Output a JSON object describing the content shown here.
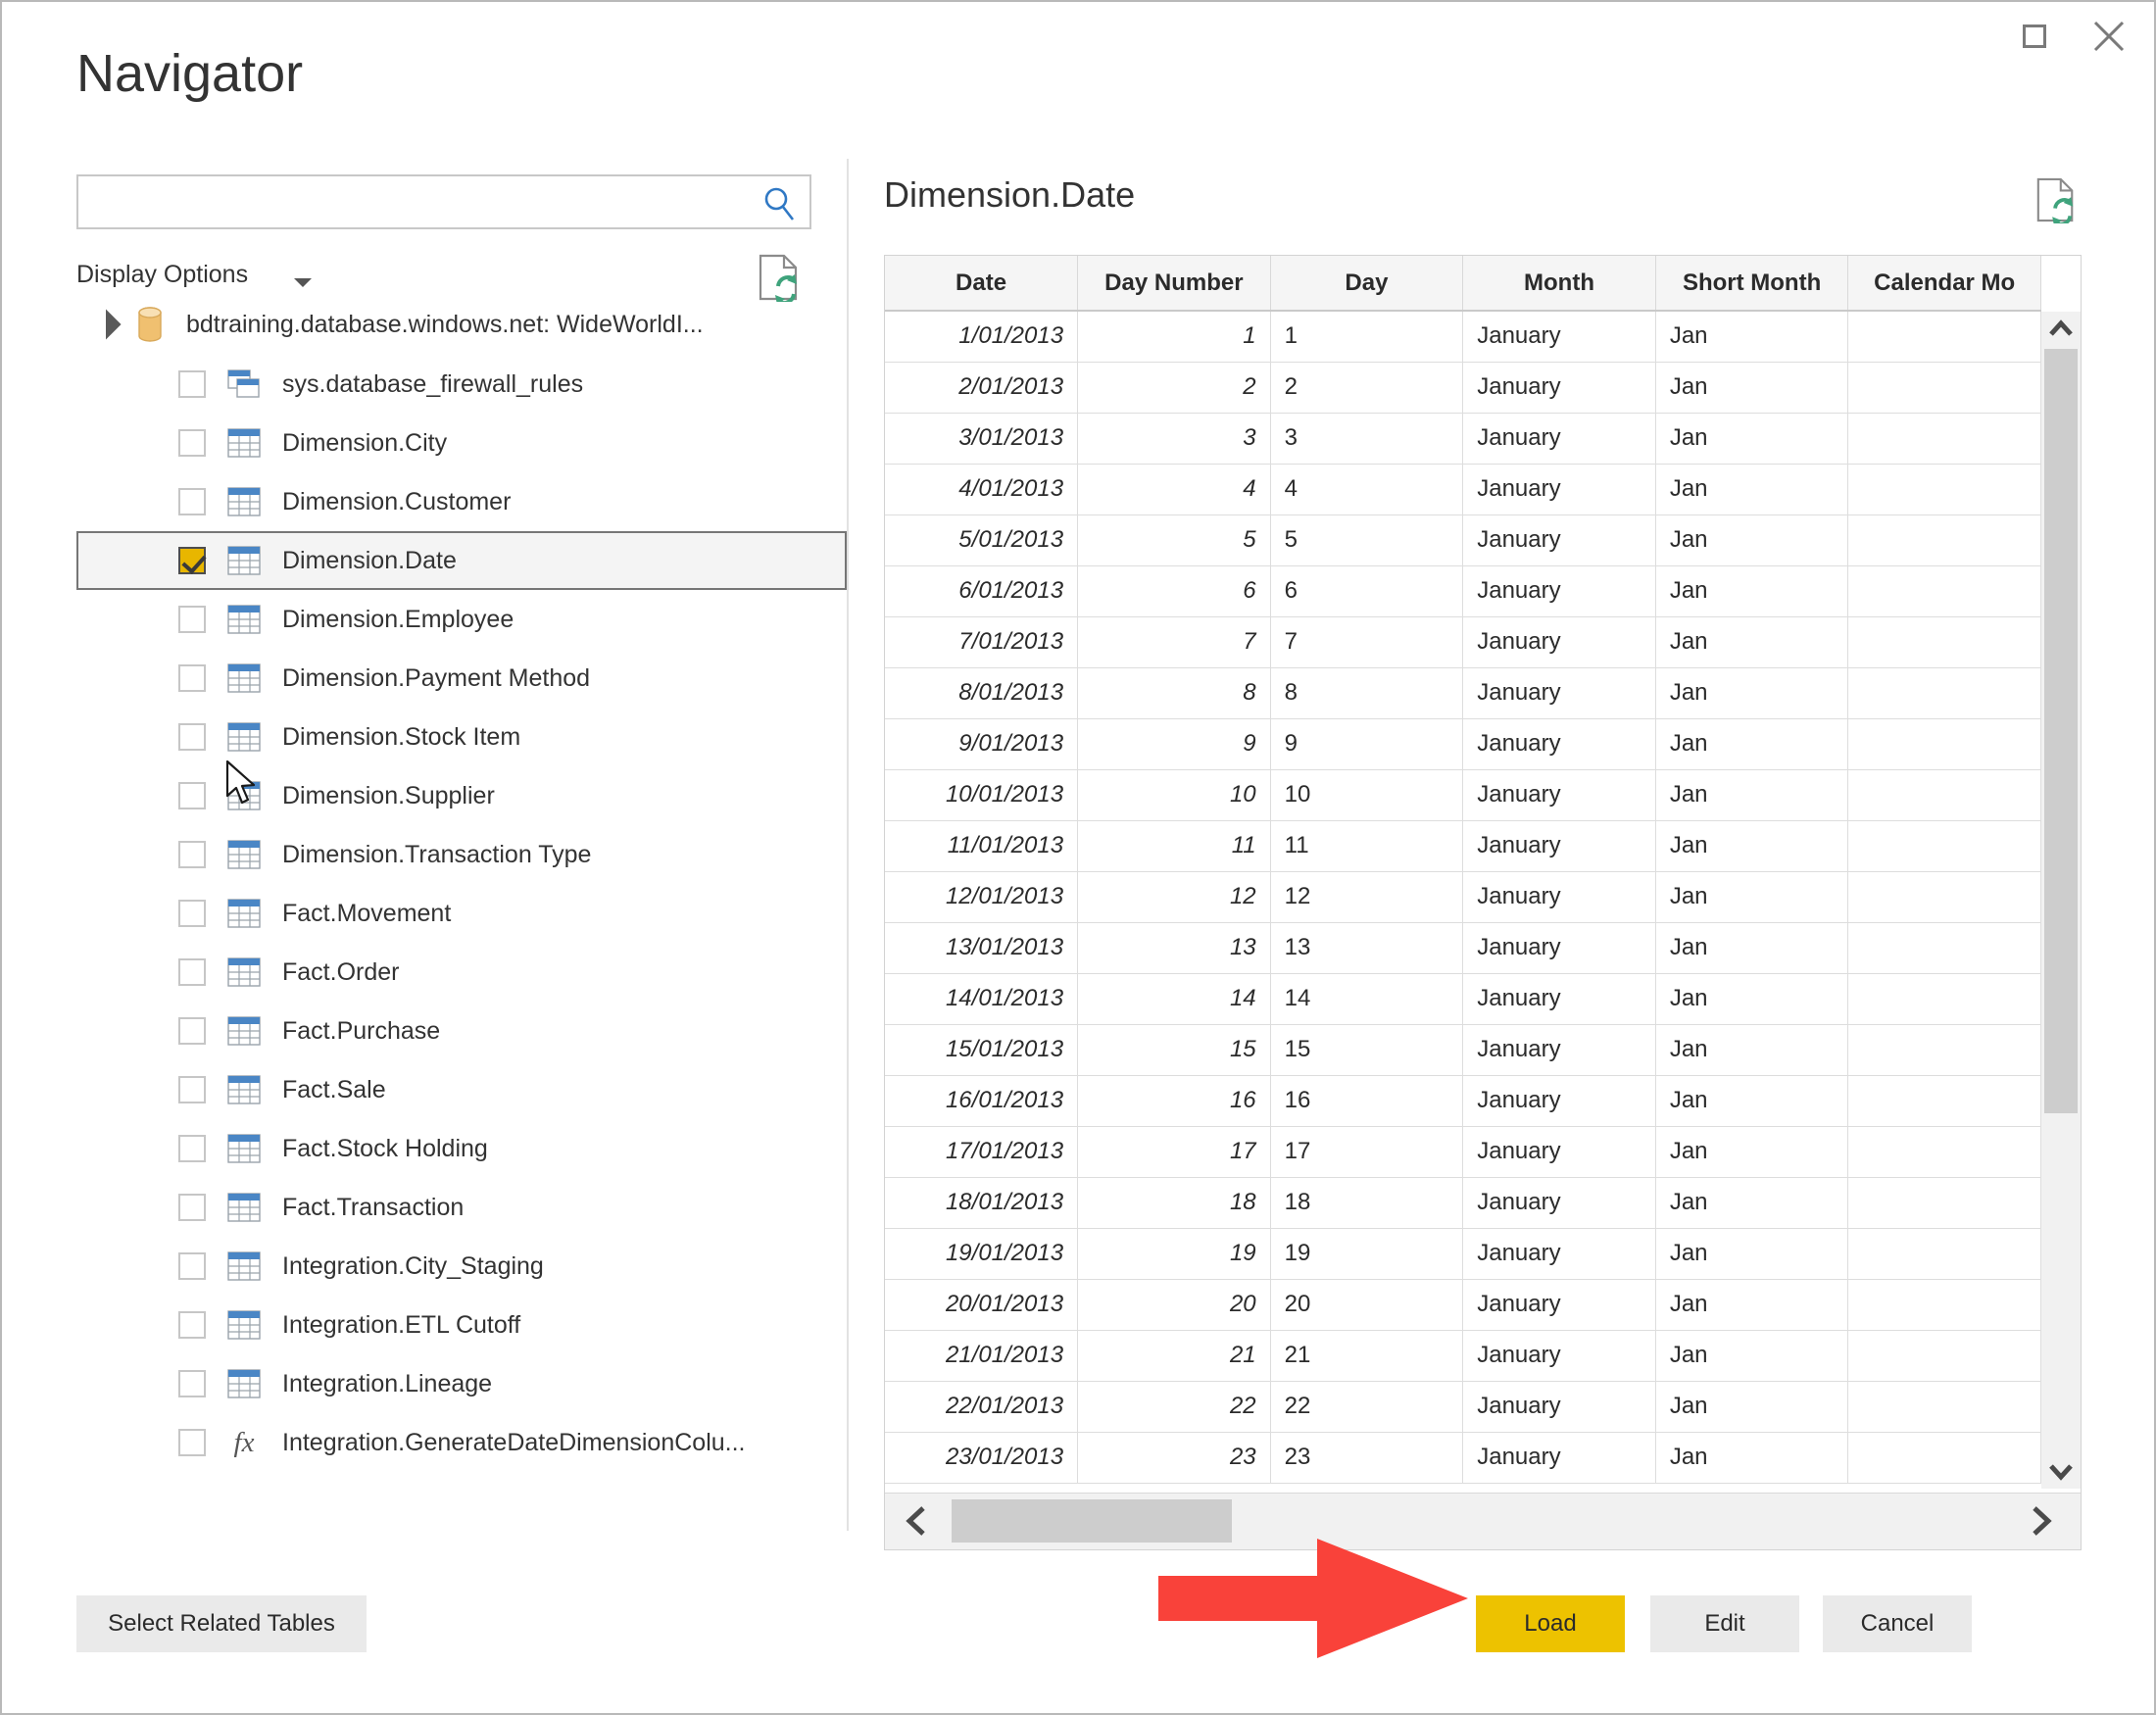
{
  "window": {
    "title": "Navigator",
    "maximize_label": "Maximize",
    "close_label": "Close"
  },
  "search": {
    "value": "",
    "placeholder": "",
    "icon": "search-icon"
  },
  "display_options": {
    "label": "Display Options",
    "caret_icon": "chevron-down-icon",
    "refresh_icon": "page-refresh-icon"
  },
  "tree": {
    "root": {
      "label": "bdtraining.database.windows.net: WideWorldI...",
      "icon": "database-icon",
      "expanded": true,
      "expander_icon": "triangle-expanded-icon"
    },
    "items": [
      {
        "label": "sys.database_firewall_rules",
        "icon": "view-icon",
        "checked": false,
        "selected": false
      },
      {
        "label": "Dimension.City",
        "icon": "table-icon",
        "checked": false,
        "selected": false
      },
      {
        "label": "Dimension.Customer",
        "icon": "table-icon",
        "checked": false,
        "selected": false
      },
      {
        "label": "Dimension.Date",
        "icon": "table-icon",
        "checked": true,
        "selected": true
      },
      {
        "label": "Dimension.Employee",
        "icon": "table-icon",
        "checked": false,
        "selected": false
      },
      {
        "label": "Dimension.Payment Method",
        "icon": "table-icon",
        "checked": false,
        "selected": false
      },
      {
        "label": "Dimension.Stock Item",
        "icon": "table-icon",
        "checked": false,
        "selected": false
      },
      {
        "label": "Dimension.Supplier",
        "icon": "table-icon",
        "checked": false,
        "selected": false
      },
      {
        "label": "Dimension.Transaction Type",
        "icon": "table-icon",
        "checked": false,
        "selected": false
      },
      {
        "label": "Fact.Movement",
        "icon": "table-icon",
        "checked": false,
        "selected": false
      },
      {
        "label": "Fact.Order",
        "icon": "table-icon",
        "checked": false,
        "selected": false
      },
      {
        "label": "Fact.Purchase",
        "icon": "table-icon",
        "checked": false,
        "selected": false
      },
      {
        "label": "Fact.Sale",
        "icon": "table-icon",
        "checked": false,
        "selected": false
      },
      {
        "label": "Fact.Stock Holding",
        "icon": "table-icon",
        "checked": false,
        "selected": false
      },
      {
        "label": "Fact.Transaction",
        "icon": "table-icon",
        "checked": false,
        "selected": false
      },
      {
        "label": "Integration.City_Staging",
        "icon": "table-icon",
        "checked": false,
        "selected": false
      },
      {
        "label": "Integration.ETL Cutoff",
        "icon": "table-icon",
        "checked": false,
        "selected": false
      },
      {
        "label": "Integration.Lineage",
        "icon": "table-icon",
        "checked": false,
        "selected": false
      },
      {
        "label": "Integration.GenerateDateDimensionColu...",
        "icon": "function-icon",
        "checked": false,
        "selected": false
      }
    ]
  },
  "preview": {
    "title": "Dimension.Date",
    "refresh_icon": "page-refresh-icon",
    "columns": [
      "Date",
      "Day Number",
      "Day",
      "Month",
      "Short Month",
      "Calendar Mo"
    ],
    "rows": [
      [
        "1/01/2013",
        "1",
        "1",
        "January",
        "Jan",
        ""
      ],
      [
        "2/01/2013",
        "2",
        "2",
        "January",
        "Jan",
        ""
      ],
      [
        "3/01/2013",
        "3",
        "3",
        "January",
        "Jan",
        ""
      ],
      [
        "4/01/2013",
        "4",
        "4",
        "January",
        "Jan",
        ""
      ],
      [
        "5/01/2013",
        "5",
        "5",
        "January",
        "Jan",
        ""
      ],
      [
        "6/01/2013",
        "6",
        "6",
        "January",
        "Jan",
        ""
      ],
      [
        "7/01/2013",
        "7",
        "7",
        "January",
        "Jan",
        ""
      ],
      [
        "8/01/2013",
        "8",
        "8",
        "January",
        "Jan",
        ""
      ],
      [
        "9/01/2013",
        "9",
        "9",
        "January",
        "Jan",
        ""
      ],
      [
        "10/01/2013",
        "10",
        "10",
        "January",
        "Jan",
        ""
      ],
      [
        "11/01/2013",
        "11",
        "11",
        "January",
        "Jan",
        ""
      ],
      [
        "12/01/2013",
        "12",
        "12",
        "January",
        "Jan",
        ""
      ],
      [
        "13/01/2013",
        "13",
        "13",
        "January",
        "Jan",
        ""
      ],
      [
        "14/01/2013",
        "14",
        "14",
        "January",
        "Jan",
        ""
      ],
      [
        "15/01/2013",
        "15",
        "15",
        "January",
        "Jan",
        ""
      ],
      [
        "16/01/2013",
        "16",
        "16",
        "January",
        "Jan",
        ""
      ],
      [
        "17/01/2013",
        "17",
        "17",
        "January",
        "Jan",
        ""
      ],
      [
        "18/01/2013",
        "18",
        "18",
        "January",
        "Jan",
        ""
      ],
      [
        "19/01/2013",
        "19",
        "19",
        "January",
        "Jan",
        ""
      ],
      [
        "20/01/2013",
        "20",
        "20",
        "January",
        "Jan",
        ""
      ],
      [
        "21/01/2013",
        "21",
        "21",
        "January",
        "Jan",
        ""
      ],
      [
        "22/01/2013",
        "22",
        "22",
        "January",
        "Jan",
        ""
      ],
      [
        "23/01/2013",
        "23",
        "23",
        "January",
        "Jan",
        ""
      ]
    ],
    "scroll": {
      "up_icon": "chevron-up-icon",
      "down_icon": "chevron-down-icon",
      "left_icon": "chevron-left-icon",
      "right_icon": "chevron-right-icon"
    }
  },
  "footer": {
    "select_related_label": "Select Related Tables",
    "load_label": "Load",
    "edit_label": "Edit",
    "cancel_label": "Cancel"
  },
  "annotation": {
    "arrow_icon": "red-arrow-pointing-right",
    "target": "Load"
  },
  "colors": {
    "accent_yellow": "#edc200",
    "checkbox_yellow": "#e8b600",
    "annotation_red": "#f9423a",
    "table_icon_blue": "#4a86c5",
    "database_icon_tan": "#f0c070"
  }
}
